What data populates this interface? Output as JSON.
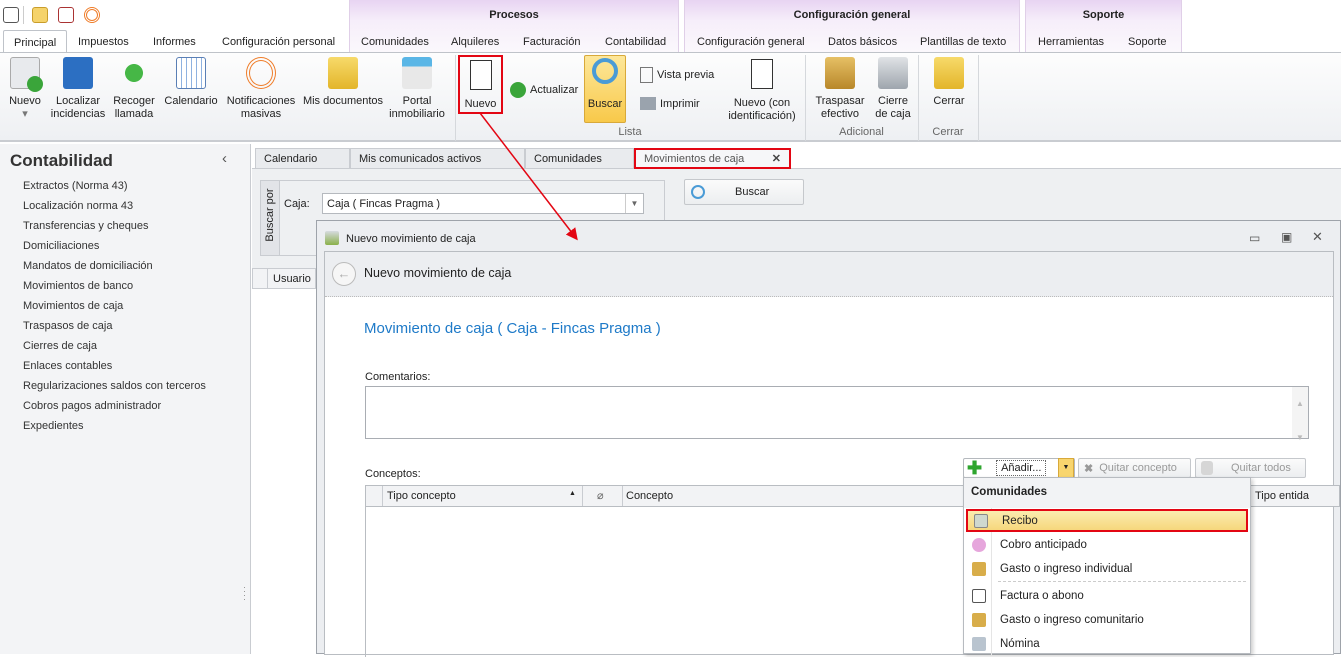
{
  "quick_access": [
    "app-menu-icon",
    "mail-icon",
    "tasks-icon",
    "notifications-icon"
  ],
  "context_groups": [
    {
      "title": "Procesos"
    },
    {
      "title": "Configuración general"
    },
    {
      "title": "Soporte"
    }
  ],
  "tabs": [
    "Principal",
    "Impuestos",
    "Informes",
    "Configuración personal",
    "Comunidades",
    "Alquileres",
    "Facturación",
    "Contabilidad",
    "Configuración general",
    "Datos básicos",
    "Plantillas de texto",
    "Herramientas",
    "Soporte"
  ],
  "ribbon": {
    "main": [
      {
        "label": "Nuevo",
        "sub": "▾"
      },
      {
        "label": "Localizar incidencias"
      },
      {
        "label": "Recoger llamada"
      },
      {
        "label": "Calendario"
      },
      {
        "label": "Notificaciones masivas"
      },
      {
        "label": "Mis documentos"
      },
      {
        "label": "Portal inmobiliario"
      }
    ],
    "lista": {
      "nuevo": "Nuevo",
      "actualizar": "Actualizar",
      "buscar": "Buscar",
      "vista_previa": "Vista previa",
      "imprimir": "Imprimir",
      "nuevo_id": "Nuevo (con identificación)",
      "label": "Lista"
    },
    "adicional": {
      "traspasar": "Traspasar efectivo",
      "cierre": "Cierre de caja",
      "label": "Adicional"
    },
    "cerrar": {
      "cerrar": "Cerrar",
      "label": "Cerrar"
    }
  },
  "sidebar": {
    "title": "Contabilidad",
    "collapse": "‹",
    "items": [
      "Extractos (Norma 43)",
      "Localización norma 43",
      "Transferencias y cheques",
      "Domiciliaciones",
      "Mandatos de domiciliación",
      "Movimientos de banco",
      "Movimientos de caja",
      "Traspasos de caja",
      "Cierres de caja",
      "Enlaces contables",
      "Regularizaciones saldos con terceros",
      "Cobros pagos administrador",
      "Expedientes"
    ]
  },
  "doc_tabs": [
    "Calendario",
    "Mis comunicados activos",
    "Comunidades",
    "Movimientos de caja"
  ],
  "doc_tab_close": "✕",
  "search": {
    "side_label": "Buscar por",
    "caja_label": "Caja:",
    "caja_value": "Caja ( Fincas Pragma )",
    "buscar": "Buscar",
    "grid_col": "Usuario"
  },
  "dialog": {
    "title": "Nuevo movimiento de caja",
    "header": "Nuevo movimiento de caja",
    "heading": "Movimiento de caja ( Caja - Fincas Pragma )",
    "comentarios_label": "Comentarios:",
    "comentarios_value": "",
    "conceptos_label": "Conceptos:",
    "add": "Añadir...",
    "remove": "Quitar concepto",
    "remove_all": "Quitar todos",
    "columns": [
      "Tipo concepto",
      "Concepto",
      "Tipo entida"
    ]
  },
  "menu": {
    "group": "Comunidades",
    "items": [
      "Recibo",
      "Cobro anticipado",
      "Gasto o ingreso individual",
      "Factura o abono",
      "Gasto o ingreso comunitario",
      "Nómina"
    ]
  },
  "colors": {
    "highlight": "#e30613",
    "accent_blue": "#1e7ac8",
    "selected": "#f8e08e"
  }
}
